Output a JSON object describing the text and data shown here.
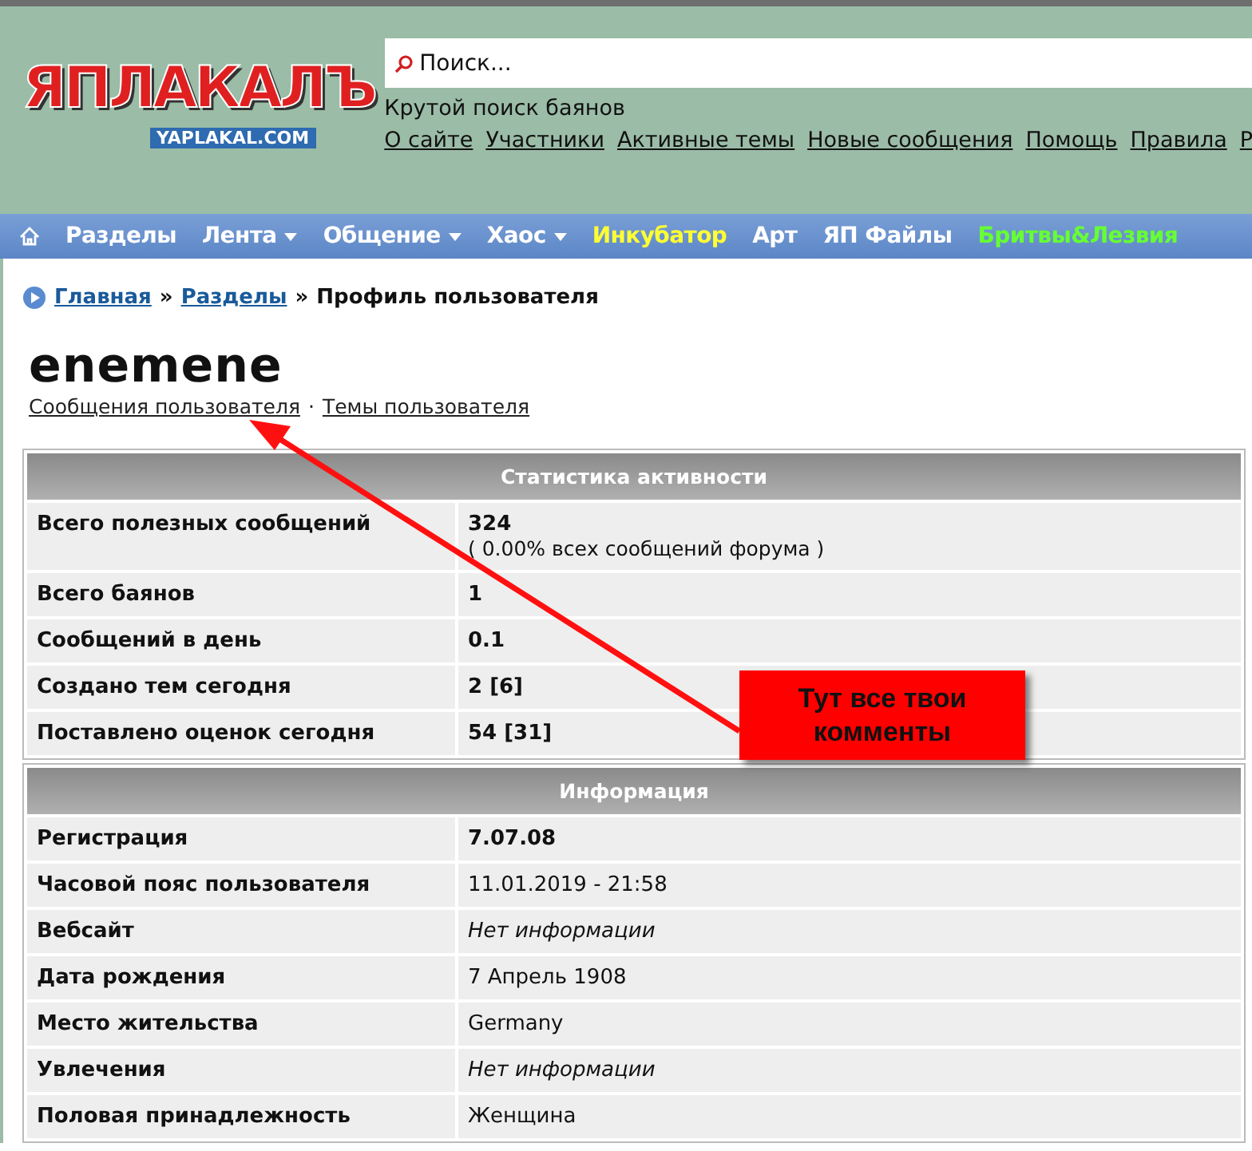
{
  "header": {
    "logo": {
      "title": "ЯПЛАКАЛЪ",
      "domain": "YAPLAKAL.COM"
    },
    "search": {
      "placeholder": "Поиск..."
    },
    "tagline": "Крутой поиск баянов",
    "links": [
      "О сайте",
      "Участники",
      "Активные темы",
      "Новые сообщения",
      "Помощь",
      "Правила",
      "Р"
    ]
  },
  "nav": [
    {
      "label": "Разделы",
      "has_menu": false,
      "color": "#ffffff"
    },
    {
      "label": "Лента",
      "has_menu": true,
      "color": "#ffffff"
    },
    {
      "label": "Общение",
      "has_menu": true,
      "color": "#ffffff"
    },
    {
      "label": "Хаос",
      "has_menu": true,
      "color": "#ffffff"
    },
    {
      "label": "Инкубатор",
      "has_menu": false,
      "color": "#ffff33"
    },
    {
      "label": "Арт",
      "has_menu": false,
      "color": "#ffffff"
    },
    {
      "label": "ЯП Файлы",
      "has_menu": false,
      "color": "#ffffff"
    },
    {
      "label": "Бритвы&Лезвия",
      "has_menu": false,
      "color": "#66ff33"
    }
  ],
  "breadcrumb": {
    "links": [
      "Главная",
      "Разделы"
    ],
    "separator": "»",
    "current": "Профиль пользователя"
  },
  "profile": {
    "username": "enemene",
    "links": [
      "Сообщения пользователя",
      "Темы пользователя"
    ],
    "link_separator": "·"
  },
  "sections": [
    {
      "title": "Статистика активности",
      "rows": [
        {
          "label": "Всего полезных сообщений",
          "value": "324",
          "kind": "bold",
          "note": "( 0.00% всех сообщений форума )"
        },
        {
          "label": "Всего баянов",
          "value": "1",
          "kind": "bold"
        },
        {
          "label": "Сообщений в день",
          "value": "0.1",
          "kind": "bold"
        },
        {
          "label": "Создано тем сегодня",
          "value": "2 [6]",
          "kind": "bold"
        },
        {
          "label": "Поставлено оценок сегодня",
          "value": "54 [31]",
          "kind": "bold"
        }
      ]
    },
    {
      "title": "Информация",
      "rows": [
        {
          "label": "Регистрация",
          "value": "7.07.08",
          "kind": "bold"
        },
        {
          "label": "Часовой пояс пользователя",
          "value": "11.01.2019 - 21:58",
          "kind": "plain"
        },
        {
          "label": "Вебсайт",
          "value": "Нет информации",
          "kind": "italic"
        },
        {
          "label": "Дата рождения",
          "value": "7 Апрель 1908",
          "kind": "plain"
        },
        {
          "label": "Место жительства",
          "value": "Germany",
          "kind": "plain"
        },
        {
          "label": "Увлечения",
          "value": "Нет информации",
          "kind": "italic"
        },
        {
          "label": "Половая принадлежность",
          "value": "Женщина",
          "kind": "plain"
        }
      ]
    }
  ],
  "callout": {
    "text": "Тут все твои комменты"
  }
}
